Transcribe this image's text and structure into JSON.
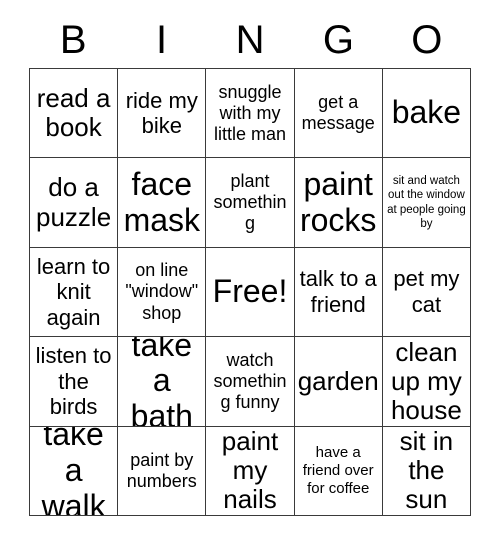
{
  "card": {
    "header_letters": [
      "B",
      "I",
      "N",
      "G",
      "O"
    ],
    "columns": 5,
    "rows": 5,
    "border_color": "#3a3a3a",
    "background_color": "#ffffff",
    "text_color": "#000000",
    "free_space": "Free!",
    "cells": [
      {
        "text": "read a book",
        "size": "xl"
      },
      {
        "text": "ride my bike",
        "size": "lg"
      },
      {
        "text": "snuggle with my little man",
        "size": "md"
      },
      {
        "text": "get a message",
        "size": "md"
      },
      {
        "text": "bake",
        "size": "xxl"
      },
      {
        "text": "do a puzzle",
        "size": "xl"
      },
      {
        "text": "face mask",
        "size": "xxl"
      },
      {
        "text": "plant something",
        "size": "md"
      },
      {
        "text": "paint rocks",
        "size": "xxl"
      },
      {
        "text": "sit and watch out the window at people going by",
        "size": "xs"
      },
      {
        "text": "learn to knit again",
        "size": "lg"
      },
      {
        "text": "on line \"window\" shop",
        "size": "md"
      },
      {
        "text": "Free!",
        "size": "xxl"
      },
      {
        "text": "talk to a friend",
        "size": "lg"
      },
      {
        "text": "pet my cat",
        "size": "lg"
      },
      {
        "text": "listen to the birds",
        "size": "lg"
      },
      {
        "text": "take a bath",
        "size": "xxl"
      },
      {
        "text": "watch something funny",
        "size": "md"
      },
      {
        "text": "garden",
        "size": "xl"
      },
      {
        "text": "clean up my house",
        "size": "xl"
      },
      {
        "text": "take a walk",
        "size": "xxl"
      },
      {
        "text": "paint by numbers",
        "size": "md"
      },
      {
        "text": "paint my nails",
        "size": "xl"
      },
      {
        "text": "have a friend over for coffee",
        "size": "sm"
      },
      {
        "text": "sit in the sun",
        "size": "xl"
      }
    ]
  }
}
